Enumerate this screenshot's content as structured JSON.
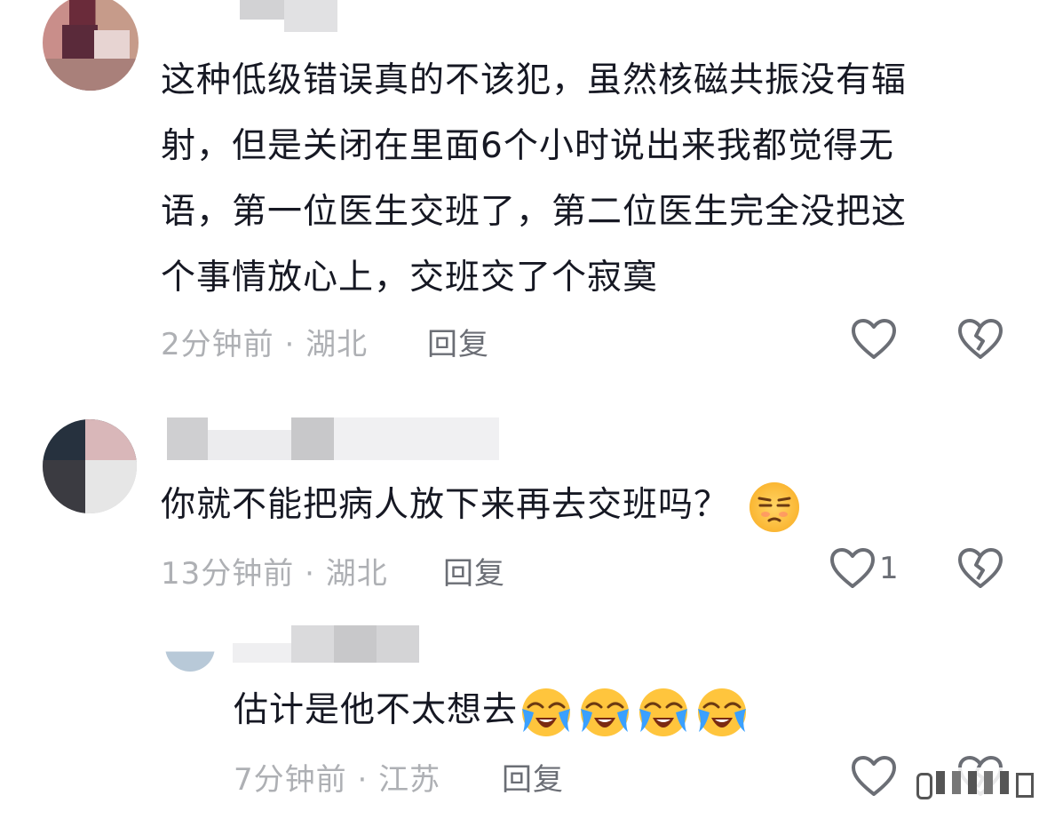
{
  "comments": [
    {
      "text_line1": "这种低级错误真的不该犯，虽然核磁共振没有辐",
      "text_line2": "射，但是关闭在里面6个小时说出来我都觉得无",
      "text_line3": "语，第一位医生交班了，第二位医生完全没把这",
      "text_line4": "个事情放心上，交班交了个寂寞",
      "time": "2分钟前",
      "location": "湖北",
      "reply_label": "回复",
      "likes": ""
    },
    {
      "text": "你就不能把病人放下来再去交班吗？",
      "emoji": "unamused-face",
      "time": "13分钟前",
      "location": "湖北",
      "reply_label": "回复",
      "likes": "1"
    },
    {
      "text": "估计是他不太想去",
      "emoji": "loudly-crying-face",
      "emoji_count": 4,
      "time": "7分钟前",
      "location": "江苏",
      "reply_label": "回复",
      "likes": ""
    }
  ],
  "separator": "·",
  "colors": {
    "meta_gray": "#aeb0b4",
    "text_dark": "#161823",
    "reply_gray": "#6b6e75",
    "icon_stroke": "#6b6e75"
  }
}
